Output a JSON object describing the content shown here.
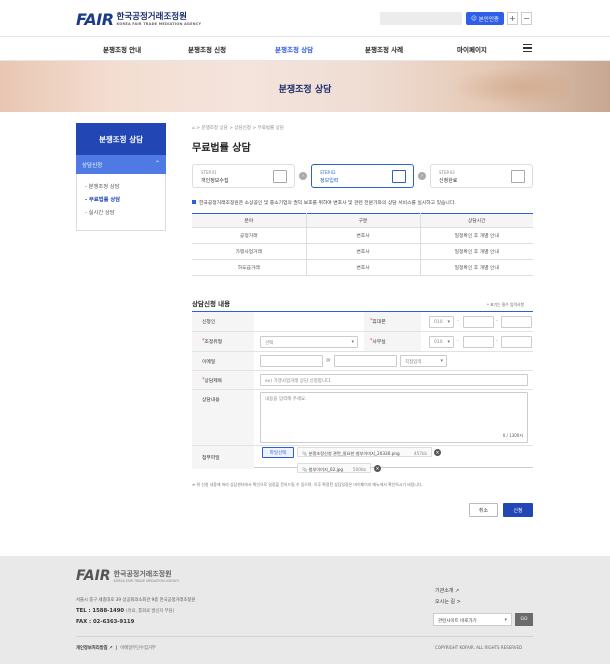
{
  "header": {
    "logo_mark": "FAIR",
    "logo_ko": "한국공정거래조정원",
    "logo_en": "KOREA FAIR TRADE MEDIATION AGENCY",
    "auth_button": "본인인증",
    "zoom_in": "+",
    "zoom_out": "−"
  },
  "nav": {
    "items": [
      "분쟁조정 안내",
      "분쟁조정 신청",
      "분쟁조정 상담",
      "분쟁조정 사례",
      "마이페이지"
    ],
    "active": "분쟁조정 상담"
  },
  "hero": {
    "title": "분쟁조정 상담"
  },
  "sidebar": {
    "title": "분쟁조정 상담",
    "section": "상담신청",
    "items": [
      "- 분쟁조정 상담",
      "- 무료법률 상담",
      "- 실시간 상담"
    ],
    "active_index": 1
  },
  "breadcrumb": "⌂  >  분쟁조정 상담  >  상담신청  >  무료법률 상담",
  "page_title": "무료법률 상담",
  "steps": [
    {
      "label": "STEP.01",
      "name": "개인정보수집"
    },
    {
      "label": "STEP.02",
      "name": "정보입력"
    },
    {
      "label": "STEP.03",
      "name": "신청완료"
    }
  ],
  "active_step_index": 1,
  "notice": "한국공정거래조정원은 소상공인 및 중소기업의 권익 보호를 위하여 변호사 및 관련 전문가와의 상담 서비스를 실시하고 있습니다.",
  "fee_table": {
    "headers": [
      "분야",
      "구분",
      "상담시간"
    ],
    "rows": [
      [
        "공정거래",
        "변호사",
        "일정확인 후 개별 안내"
      ],
      [
        "가맹사업거래",
        "변호사",
        "일정확인 후 개별 안내"
      ],
      [
        "하도급거래",
        "변호사",
        "일정확인 후 개별 안내"
      ]
    ]
  },
  "form": {
    "title": "상담신청 내용",
    "required_note": "* 표기는 필수 입력사항",
    "fields": {
      "applicant": "신청인",
      "mobile": "* 휴대폰",
      "type": "* 조정유형",
      "office": "* 사무실",
      "email": "이메일",
      "subject": "* 상담제목",
      "content": "상담내용",
      "attach": "첨부파일"
    },
    "phone_prefix": "010",
    "type_select": "선택",
    "email_at": "@",
    "email_domain_select": "직접입력",
    "subject_placeholder": "ex) 가맹사업거래 상담 신청합니다.",
    "content_placeholder": "내용을 입력해 주세요.",
    "char_count": "0 / 1300자",
    "attach_button": "파일선택",
    "files": [
      {
        "name": "분쟁조정신청 관련_필요한 첨부이미지_20330.png",
        "size": "457kb"
      },
      {
        "name": "첨부이미지_02.jpg",
        "size": "500kb"
      }
    ],
    "footnote": "※ 위 신청 내용에 따라 상담센터에서 확인으로 일정을 문의드릴 수 있으며, 이후 확정된 상담일정은 마이페이지 메뉴에서 확인하시기 바랍니다.",
    "cancel": "취소",
    "submit": "신청"
  },
  "footer": {
    "logo_mark": "FAIR",
    "logo_ko": "한국공정거래조정원",
    "logo_en": "KOREA FAIR TRADE MEDIATION AGENCY",
    "address": "서울시 중구 세종대로 39 상공회의소회관 9층 한국공정거래조정원",
    "tel": "TEL : 1588-1490",
    "tel_note": "(유료, 통화료 발신자 부담)",
    "fax": "FAX : 02-6363-9119",
    "links": [
      "기관소개 ↗",
      "오시는 길 >"
    ],
    "site_select": "관련사이트 바로가기",
    "go": "GO",
    "privacy": "개인정보처리방침 ↗",
    "email_policy": "이메일무단수집거부",
    "copyright": "COPYRIGHT KOFAIR. ALL RIGHTS RESERVED"
  }
}
